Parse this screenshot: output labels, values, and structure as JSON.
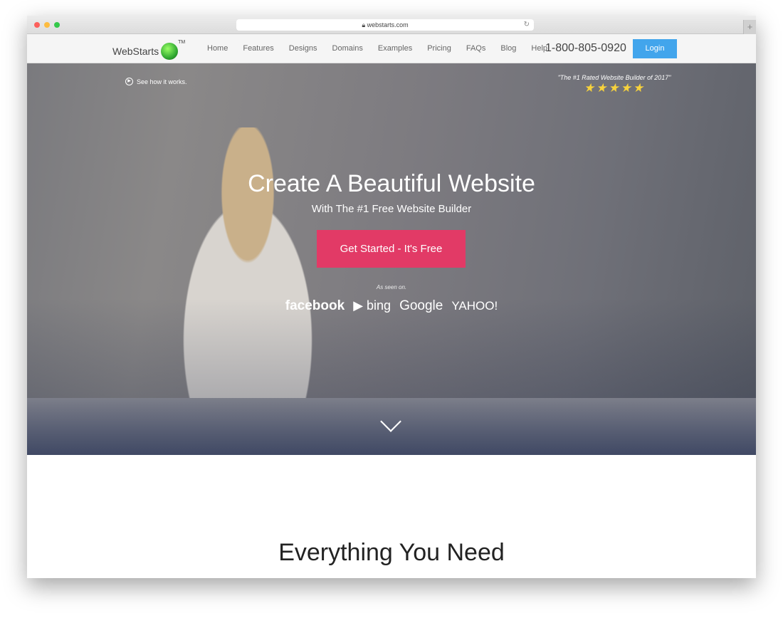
{
  "browser": {
    "url": "webstarts.com",
    "traffic_lights": [
      "#fc605c",
      "#fdbc40",
      "#34c84a"
    ]
  },
  "nav": {
    "logo": "WebStarts",
    "tm": "TM",
    "links": [
      "Home",
      "Features",
      "Designs",
      "Domains",
      "Examples",
      "Pricing",
      "FAQs",
      "Blog",
      "Help"
    ],
    "phone": "1-800-805-0920",
    "login": "Login"
  },
  "hero": {
    "see_how": "See how it works.",
    "rating_quote": "\"The #1 Rated Website Builder of 2017\"",
    "stars": "★★★★★",
    "star_count": 5,
    "title": "Create A Beautiful Website",
    "subtitle": "With The #1 Free Website Builder",
    "cta": "Get Started - It's Free",
    "as_seen_on": "As seen on.",
    "press": [
      "facebook",
      "bing",
      "Google",
      "YAHOO!"
    ]
  },
  "section": {
    "title": "Everything You Need"
  },
  "colors": {
    "login": "#42a5ec",
    "cta": "#e23a66",
    "stars": "#f7d23c"
  }
}
